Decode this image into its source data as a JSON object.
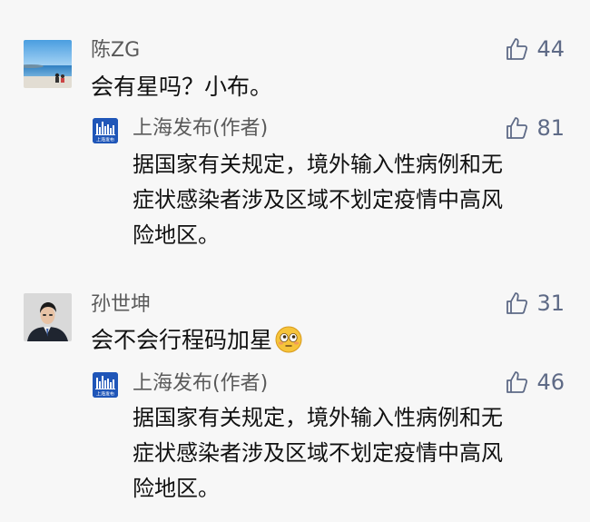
{
  "comments": [
    {
      "user": "陈ZG",
      "text": "会有星吗？小布。",
      "likes": "44",
      "reply": {
        "author": "上海发布(作者)",
        "likes": "81",
        "lines": [
          "据国家有关规定，境外输入性病例和无",
          "症状感染者涉及区域不划定疫情中高风",
          "险地区。"
        ]
      }
    },
    {
      "user": "孙世坤",
      "text": "会不会行程码加星",
      "emoji": "flushed-face",
      "likes": "31",
      "reply": {
        "author": "上海发布(作者)",
        "likes": "46",
        "lines": [
          "据国家有关规定，境外输入性病例和无",
          "症状感染者涉及区域不划定疫情中高风",
          "险地区。"
        ]
      }
    }
  ],
  "icons": {
    "like": "thumbs-up-icon"
  },
  "colors": {
    "background": "#f7f7f7",
    "like_icon": "#5e6a86",
    "logo_blue": "#1f56b8"
  },
  "logo": {
    "text": "上海发布"
  }
}
